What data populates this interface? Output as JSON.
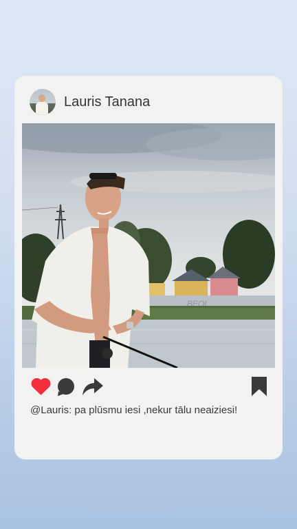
{
  "post": {
    "username": "Lauris Tanana",
    "caption": "@Lauris: pa plūsmu iesi ,nekur tālu neaiziesi!",
    "photo_subject": "young man in white shirt holding fishing rod by river"
  },
  "icons": {
    "like": "heart-icon",
    "comment": "comment-bubble-icon",
    "share": "share-arrow-icon",
    "save": "bookmark-icon"
  },
  "colors": {
    "like": "#f22f3f",
    "icons": "#3a3a3a",
    "card": "#f2f2f2"
  }
}
